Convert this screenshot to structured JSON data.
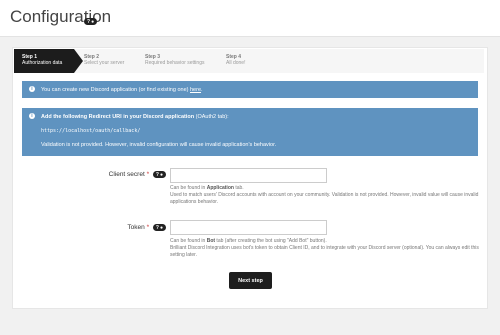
{
  "page": {
    "title": "Configuration",
    "help_badge": "?"
  },
  "wizard": {
    "steps": [
      {
        "title": "Step 1",
        "subtitle": "Authorization data"
      },
      {
        "title": "Step 2",
        "subtitle": "Select your server"
      },
      {
        "title": "Step 3",
        "subtitle": "Required behavior settings"
      },
      {
        "title": "Step 4",
        "subtitle": "All done!"
      }
    ]
  },
  "alerts": {
    "create_app_text": "You can create new Discord application (or find existing one) ",
    "create_app_link": "here",
    "create_app_suffix": ".",
    "redirect_title": "Add the following Redirect URI in your Discord application",
    "redirect_title_note": " (OAuth2 tab):",
    "redirect_uri": "https://localhost/oauth/callback/",
    "validation_note": "Validation is not provided. However, invalid configuration will cause invalid application's behavior."
  },
  "form": {
    "client_secret": {
      "label": "Client secret",
      "required_mark": "*",
      "help_badge": "?",
      "value": "",
      "hint_prefix": "Can be found in ",
      "hint_bold": "Application",
      "hint_suffix": " tab.",
      "hint_line2": "Used to match users' Discord accounts with account on your community. Validation is not provided. However, invalid value will cause invalid applications behavior."
    },
    "token": {
      "label": "Token",
      "required_mark": "*",
      "help_badge": "?",
      "value": "",
      "hint_prefix": "Can be found in ",
      "hint_bold": "Bot",
      "hint_suffix": " tab (after creating the bot using \"Add Bot\" button).",
      "hint_line2": "Brilliant Discord Integration uses bot's token to obtain Client ID, and to integrate with your Discord server (optional). You can always edit this setting later."
    }
  },
  "actions": {
    "next_label": "Next step"
  },
  "colors": {
    "info_alert": "#5f93c0",
    "wizard_active": "#1c1c1c",
    "primary_button": "#1e1e1e"
  }
}
